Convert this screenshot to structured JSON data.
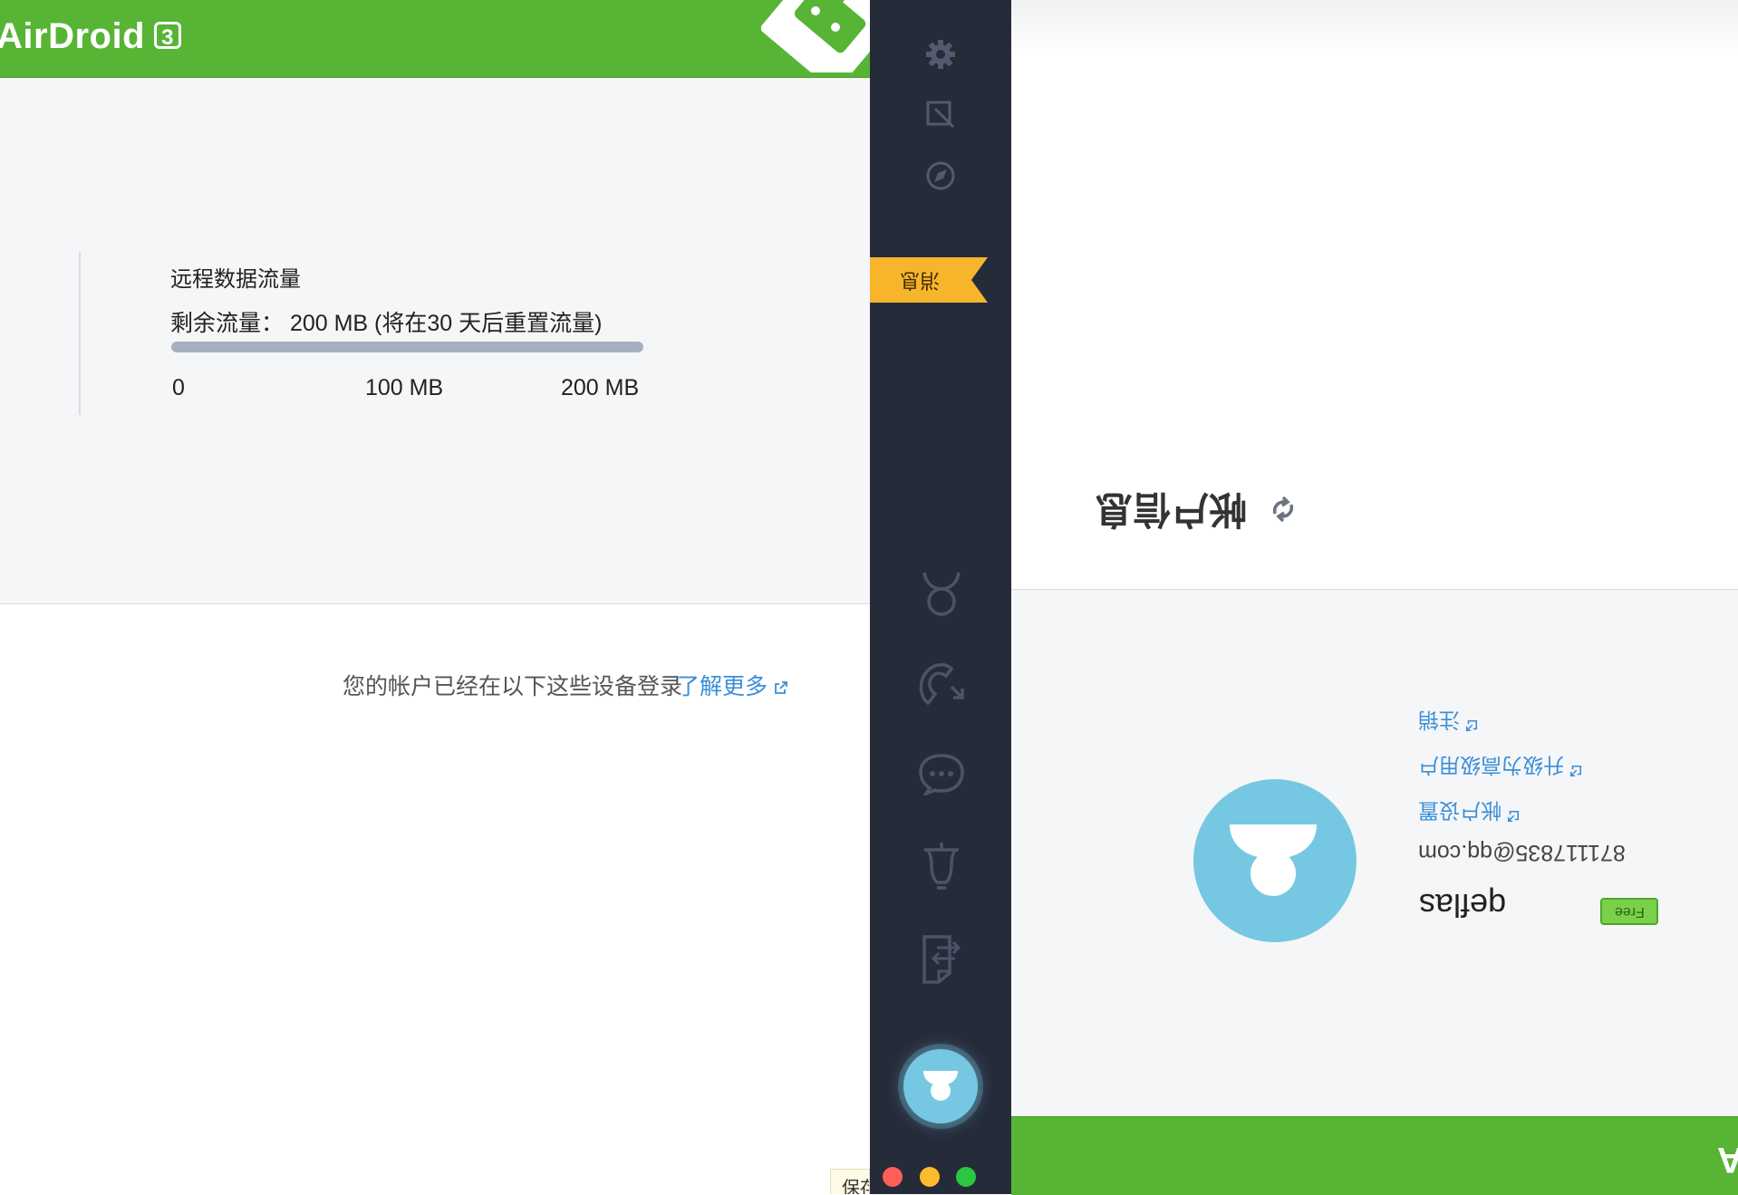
{
  "app": {
    "brand": "AirDroid",
    "version_badge": "3",
    "accent_color": "#57b435",
    "sidebar_color": "#262b3a",
    "link_color": "#3a8ed8",
    "avatar_color": "#76c8e2"
  },
  "usage": {
    "title": "远程数据流量",
    "remaining": "剩余流量： 200 MB (将在30 天后重置流量)",
    "remaining_fraction": 1.0,
    "ticks": [
      "0",
      "100 MB",
      "200 MB"
    ]
  },
  "devices": {
    "text": "您的帐户已经在以下这些设备登录",
    "learn_more": "了解更多"
  },
  "corner_tab": {
    "label": "保存"
  },
  "sidebar": {
    "ribbon_label": "消息",
    "ribbon_color": "#f7b52b",
    "top_icons": [
      "gear-icon",
      "edit-icon",
      "compass-icon"
    ],
    "nav_icons": [
      "person-icon",
      "phone-icon",
      "chat-icon",
      "bell-icon",
      "file-transfer-icon"
    ],
    "window_controls": [
      "close-dot",
      "minimize-dot",
      "zoom-dot"
    ]
  },
  "account": {
    "title": "帐户信息",
    "links": [
      "注销",
      "升级为高级用户",
      "帐户设置"
    ],
    "email": "871117835@qq.com",
    "username": "qeflas",
    "plan_badge": "Free"
  },
  "footer": {
    "brand_cut": "A"
  }
}
